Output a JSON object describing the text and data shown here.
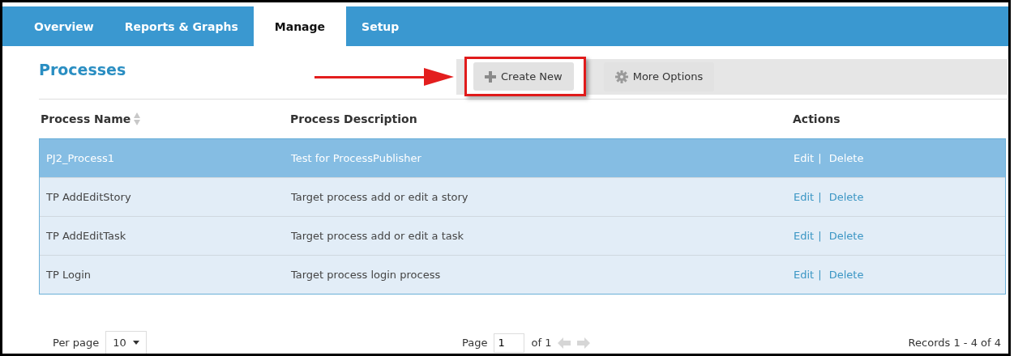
{
  "tabs": [
    {
      "label": "Overview",
      "selected": false
    },
    {
      "label": "Reports & Graphs",
      "selected": false
    },
    {
      "label": "Manage",
      "selected": true
    },
    {
      "label": "Setup",
      "selected": false
    }
  ],
  "title": "Processes",
  "toolbar": [
    {
      "label": "Create New",
      "kind": "create",
      "highlighted": true
    },
    {
      "label": "More Options",
      "kind": "options",
      "highlighted": false
    }
  ],
  "table": {
    "columns": [
      {
        "label": "Process Name",
        "sortable": true
      },
      {
        "label": "Process Description",
        "sortable": false
      },
      {
        "label": "Actions",
        "sortable": false
      }
    ],
    "action_separator": "|",
    "rows": [
      {
        "name": "PJ2_Process1",
        "description": "Test for ProcessPublisher",
        "actions": [
          "Edit",
          "Delete"
        ],
        "selected": true
      },
      {
        "name": "TP AddEditStory",
        "description": "Target process add or edit a story",
        "actions": [
          "Edit",
          "Delete"
        ],
        "selected": false
      },
      {
        "name": "TP AddEditTask",
        "description": "Target process add or edit a task",
        "actions": [
          "Edit",
          "Delete"
        ],
        "selected": false
      },
      {
        "name": "TP Login",
        "description": "Target process login process",
        "actions": [
          "Edit",
          "Delete"
        ],
        "selected": false
      }
    ]
  },
  "pager": {
    "per_page_label": "Per page",
    "per_page": "10",
    "page_label": "Page",
    "page": "1",
    "of": "of 1",
    "prev_disabled": true,
    "next_disabled": true,
    "records": "Records 1 - 4 of 4"
  }
}
